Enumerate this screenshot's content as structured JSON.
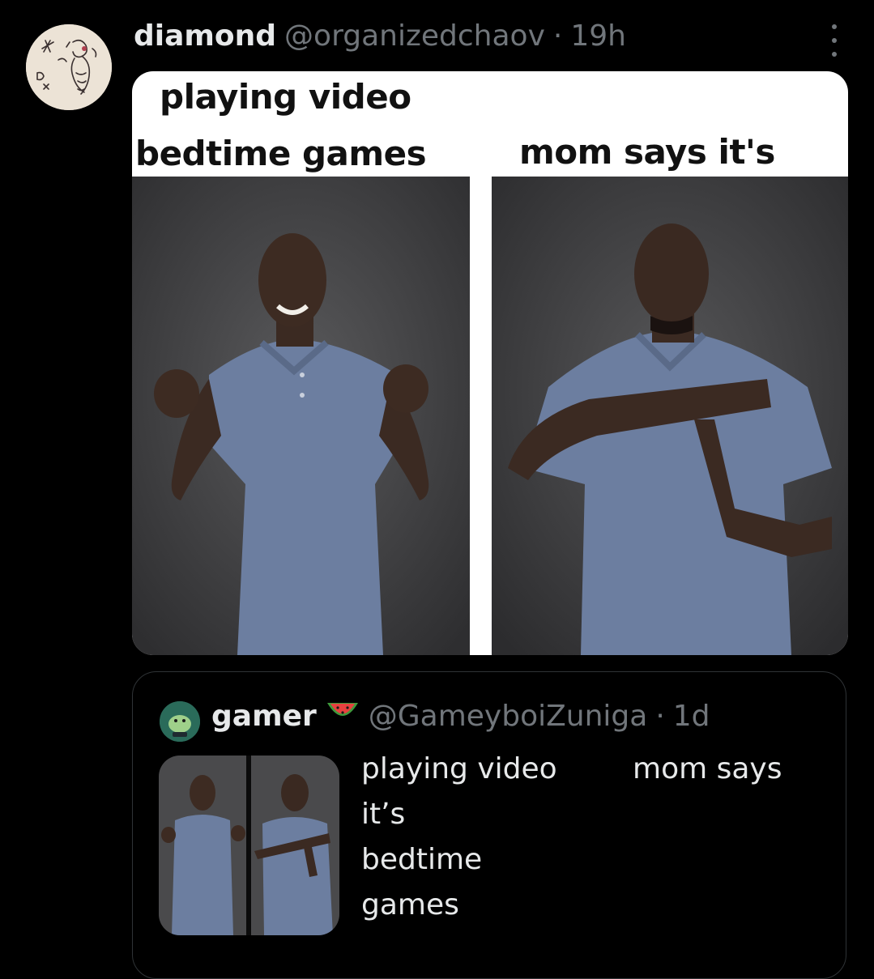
{
  "post": {
    "display_name": "diamond",
    "handle": "@organizedchaov",
    "separator": "·",
    "time": "19h",
    "more_icon": "more-dots-icon",
    "meme": {
      "caption_left_line1": "playing video",
      "caption_left_line2": "bedtime games",
      "caption_right": "mom says it's"
    }
  },
  "quoted_post": {
    "display_name": "gamer",
    "name_emoji": "watermelon-icon",
    "handle": "@GameyboiZuniga",
    "separator": "·",
    "time": "1d",
    "text_lines": [
      "playing video",
      "it’s",
      "bedtime",
      "games"
    ],
    "text_right": "mom says"
  },
  "colors": {
    "background": "#000000",
    "text_primary": "#e7e9ea",
    "text_secondary": "#71767b",
    "border": "#2f3336",
    "shirt": "#6c7ea0",
    "backdrop": "#4a4a4c"
  }
}
